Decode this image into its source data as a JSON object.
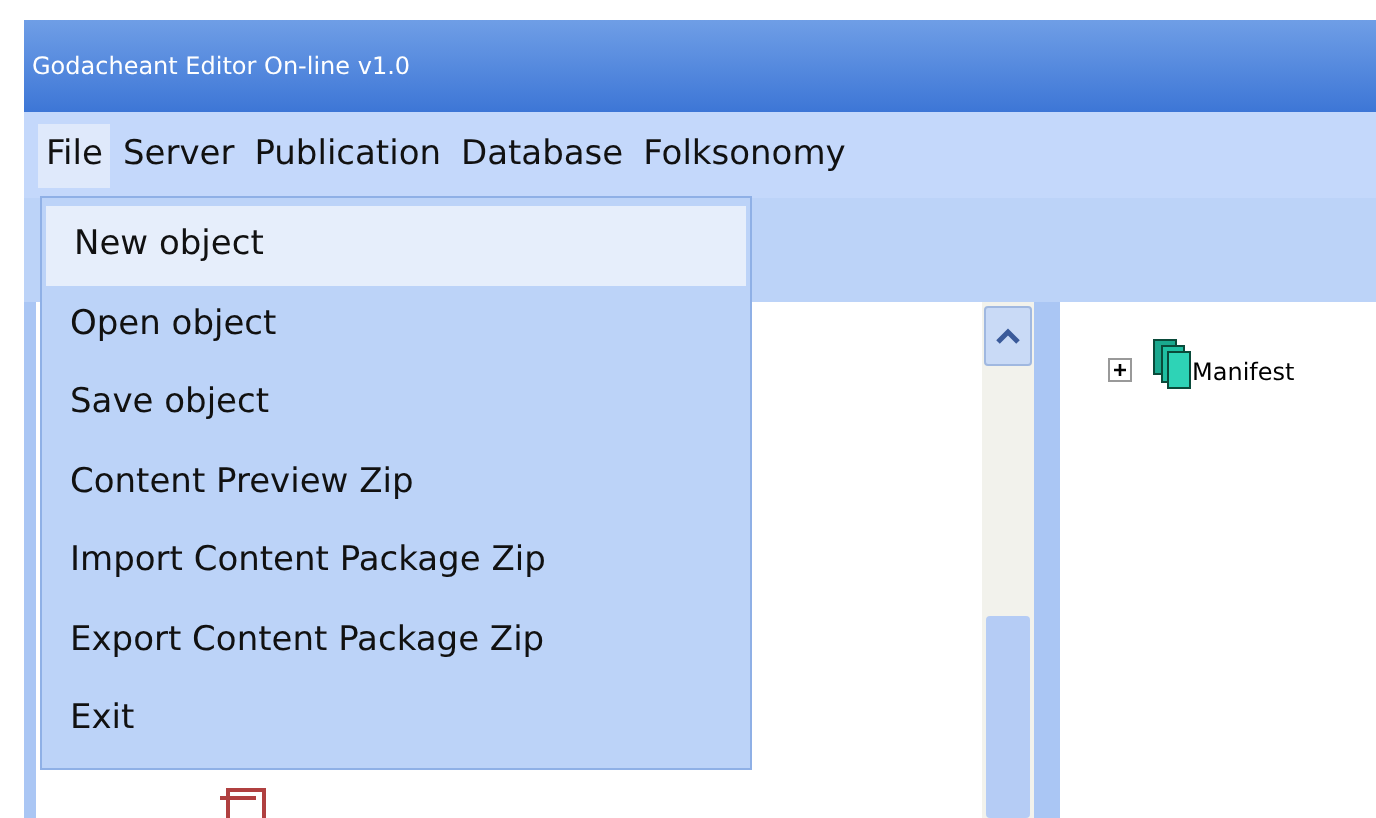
{
  "window": {
    "title": "Godacheant Editor On-line v1.0"
  },
  "menu_bar": [
    {
      "label": "File",
      "selected": true
    },
    {
      "label": "Server",
      "selected": false
    },
    {
      "label": "Publication",
      "selected": false
    },
    {
      "label": "Database",
      "selected": false
    },
    {
      "label": "Folksonomy",
      "selected": false
    }
  ],
  "file_menu": [
    {
      "label": "New object",
      "selected": true
    },
    {
      "label": "Open object",
      "selected": false
    },
    {
      "label": "Save object",
      "selected": false
    },
    {
      "label": "Content Preview Zip",
      "selected": false
    },
    {
      "label": "Import Content Package Zip",
      "selected": false
    },
    {
      "label": "Export Content Package Zip",
      "selected": false
    },
    {
      "label": "Exit",
      "selected": false
    }
  ],
  "tree": [
    {
      "label": "Manifest",
      "expanded": false
    }
  ]
}
